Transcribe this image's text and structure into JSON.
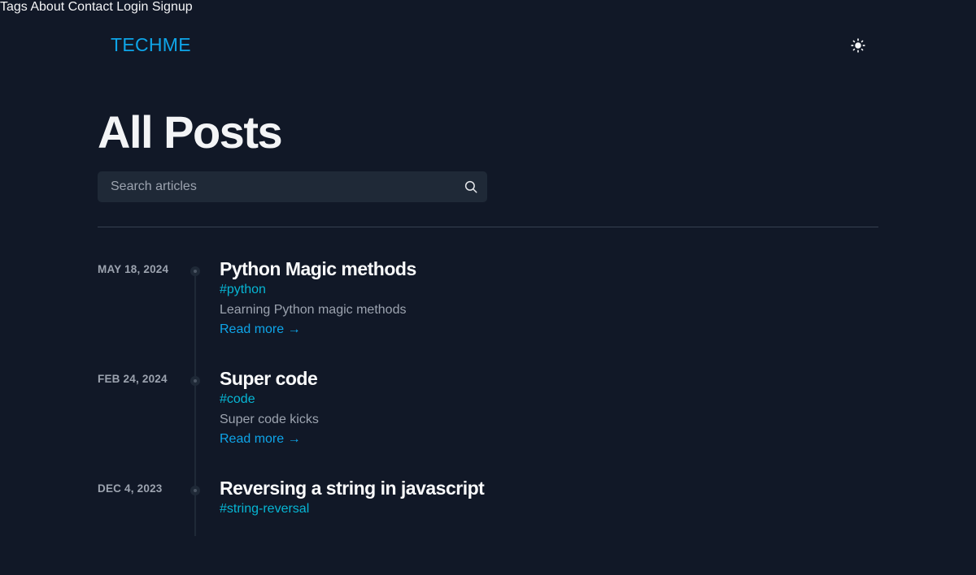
{
  "header": {
    "logo": "TECHME",
    "nav": [
      {
        "label": "Tags"
      },
      {
        "label": "About"
      },
      {
        "label": "Contact"
      },
      {
        "label": "Login"
      },
      {
        "label": "Signup"
      }
    ],
    "theme_toggle_icon": "sun-icon"
  },
  "page": {
    "title": "All Posts",
    "search": {
      "placeholder": "Search articles",
      "value": ""
    }
  },
  "posts": [
    {
      "date": "MAY 18, 2024",
      "title": "Python Magic methods",
      "tag": "#python",
      "description": "Learning Python magic methods",
      "read_more": "Read more →"
    },
    {
      "date": "FEB 24, 2024",
      "title": "Super code",
      "tag": "#code",
      "description": "Super code kicks",
      "read_more": "Read more →"
    },
    {
      "date": "DEC 4, 2023",
      "title": "Reversing a string in javascript",
      "tag": "#string-reversal",
      "description": "",
      "read_more": ""
    }
  ],
  "colors": {
    "background": "#111827",
    "accent": "#0ea5e9",
    "tag": "#06b6d4",
    "text": "#f3f4f6",
    "muted": "#9ca3af"
  }
}
